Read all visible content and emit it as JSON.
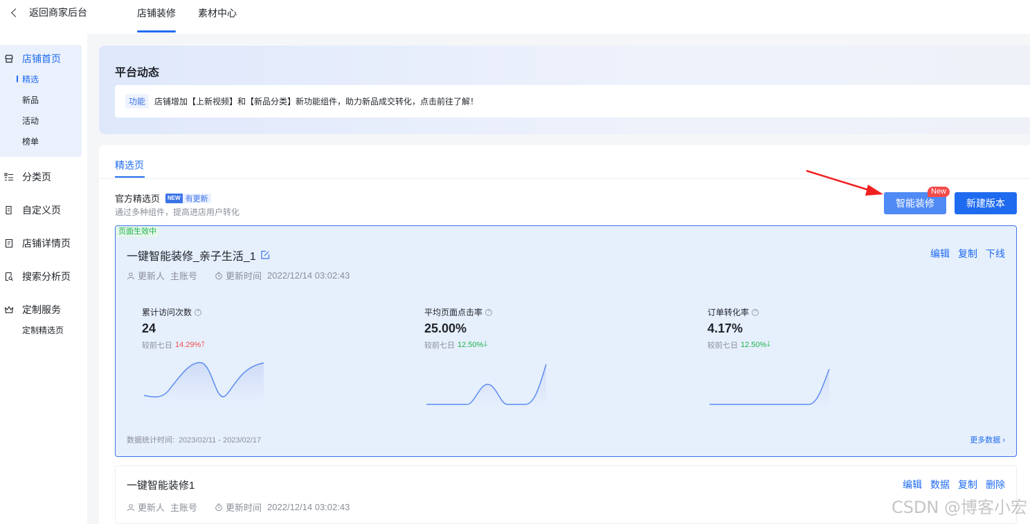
{
  "topbar": {
    "back_label": "返回商家后台",
    "tabs": [
      {
        "label": "店铺装修"
      },
      {
        "label": "素材中心"
      }
    ]
  },
  "sidebar": {
    "items": [
      {
        "label": "店铺首页",
        "icon": "storefront-icon",
        "sub": [
          "精选",
          "新品",
          "活动",
          "榜单"
        ]
      },
      {
        "label": "分类页",
        "icon": "category-list-icon"
      },
      {
        "label": "自定义页",
        "icon": "custom-page-icon"
      },
      {
        "label": "店铺详情页",
        "icon": "store-detail-icon"
      },
      {
        "label": "搜索分析页",
        "icon": "search-analysis-icon"
      },
      {
        "label": "定制服务",
        "icon": "crown-icon",
        "sub": [
          "定制精选页"
        ]
      }
    ]
  },
  "platform": {
    "title": "平台动态",
    "tag": "功能",
    "notice": "店铺增加【上新视频】和【新品分类】新功能组件，助力新品成交转化，点击前往了解！"
  },
  "main": {
    "page_tab": "精选页",
    "section_title": "官方精选页",
    "badge_new": "NEW",
    "badge_text": "有更新",
    "section_sub": "通过多种组件，提高进店用户转化",
    "btn_smart": "智能装修",
    "btn_smart_pill": "New",
    "btn_new": "新建版本"
  },
  "active_version": {
    "live_tag": "页面生效中",
    "name": "一键智能装修_亲子生活_1",
    "updater_label": "更新人",
    "updater": "主账号",
    "time_label": "更新时间",
    "time": "2022/12/14 03:02:43",
    "actions": [
      "编辑",
      "复制",
      "下线"
    ],
    "metrics": [
      {
        "label": "累计访问次数",
        "value": "24",
        "cmp_label": "较前七日",
        "cmp": "14.29%",
        "dir": "up"
      },
      {
        "label": "平均页面点击率",
        "value": "25.00%",
        "cmp_label": "较前七日",
        "cmp": "12.50%",
        "dir": "down"
      },
      {
        "label": "订单转化率",
        "value": "4.17%",
        "cmp_label": "较前七日",
        "cmp": "12.50%",
        "dir": "down"
      }
    ],
    "footer_label": "数据统计时间:",
    "footer_range": "2023/02/11 - 2023/02/17",
    "more": "更多数据"
  },
  "version2": {
    "name": "一键智能装修1",
    "updater_label": "更新人",
    "updater": "主账号",
    "time_label": "更新时间",
    "time": "2022/12/14 03:02:43",
    "actions": [
      "编辑",
      "数据",
      "复制",
      "删除"
    ]
  },
  "watermark": "CSDN @博客小宏",
  "colors": {
    "primary": "#1f6bf0",
    "up": "#f34b4b",
    "down": "#19b34b",
    "annotation_arrow": "#f02020"
  }
}
